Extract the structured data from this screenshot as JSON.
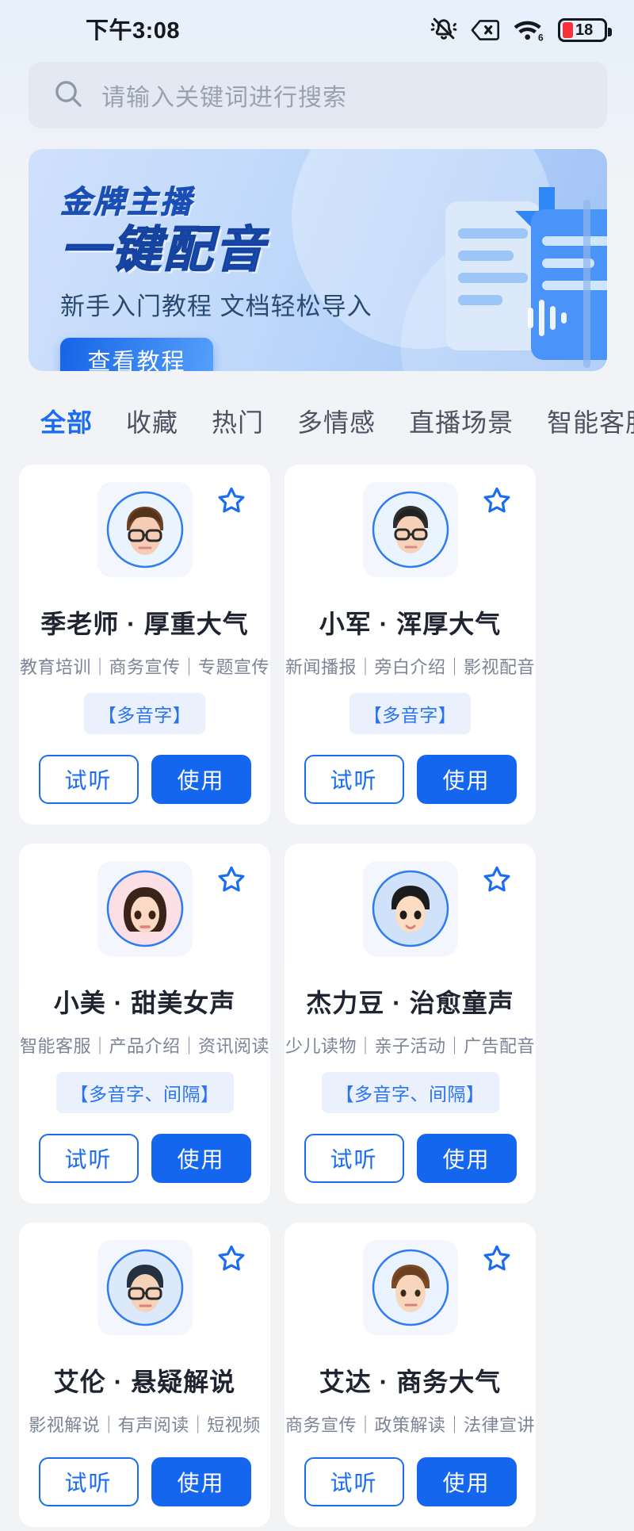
{
  "status_bar": {
    "time": "下午3:08",
    "battery_percent": "18",
    "icons": [
      "bell-mute-icon",
      "no-sim-icon",
      "wifi-6-icon",
      "battery-low-icon"
    ]
  },
  "search": {
    "placeholder": "请输入关键词进行搜索",
    "icon": "search-icon"
  },
  "banner": {
    "title_small": "金牌主播",
    "title_large": "一键配音",
    "subtitle": "新手入门教程 文档轻松导入",
    "cta_label": "查看教程",
    "accent_color": "#1664e8"
  },
  "tabs": [
    {
      "label": "全部",
      "active": true
    },
    {
      "label": "收藏",
      "active": false
    },
    {
      "label": "热门",
      "active": false
    },
    {
      "label": "多情感",
      "active": false
    },
    {
      "label": "直播场景",
      "active": false
    },
    {
      "label": "智能客服",
      "active": false
    }
  ],
  "buttons": {
    "preview": "试听",
    "use": "使用"
  },
  "voices": [
    {
      "name": "季老师 · 厚重大气",
      "tags": "教育培训｜商务宣传｜专题宣传",
      "badge": "【多音字】",
      "avatar": "man-glasses-brown-hair",
      "favorited": false
    },
    {
      "name": "小军 · 浑厚大气",
      "tags": "新闻播报｜旁白介绍｜影视配音",
      "badge": "【多音字】",
      "avatar": "man-glasses-short-hair",
      "favorited": false
    },
    {
      "name": "小美 · 甜美女声",
      "tags": "智能客服｜产品介绍｜资讯阅读",
      "badge": "【多音字、间隔】",
      "avatar": "woman-long-dark-hair",
      "favorited": false
    },
    {
      "name": "杰力豆 · 治愈童声",
      "tags": "少儿读物｜亲子活动｜广告配音",
      "badge": "【多音字、间隔】",
      "avatar": "boy-short-black-hair",
      "favorited": false
    },
    {
      "name": "艾伦 · 悬疑解说",
      "tags": "影视解说｜有声阅读｜短视频",
      "badge": "",
      "avatar": "man-glasses-dark-hair",
      "favorited": false
    },
    {
      "name": "艾达 · 商务大气",
      "tags": "商务宣传｜政策解读｜法律宣讲",
      "badge": "",
      "avatar": "man-brown-wavy-hair",
      "favorited": false
    }
  ]
}
